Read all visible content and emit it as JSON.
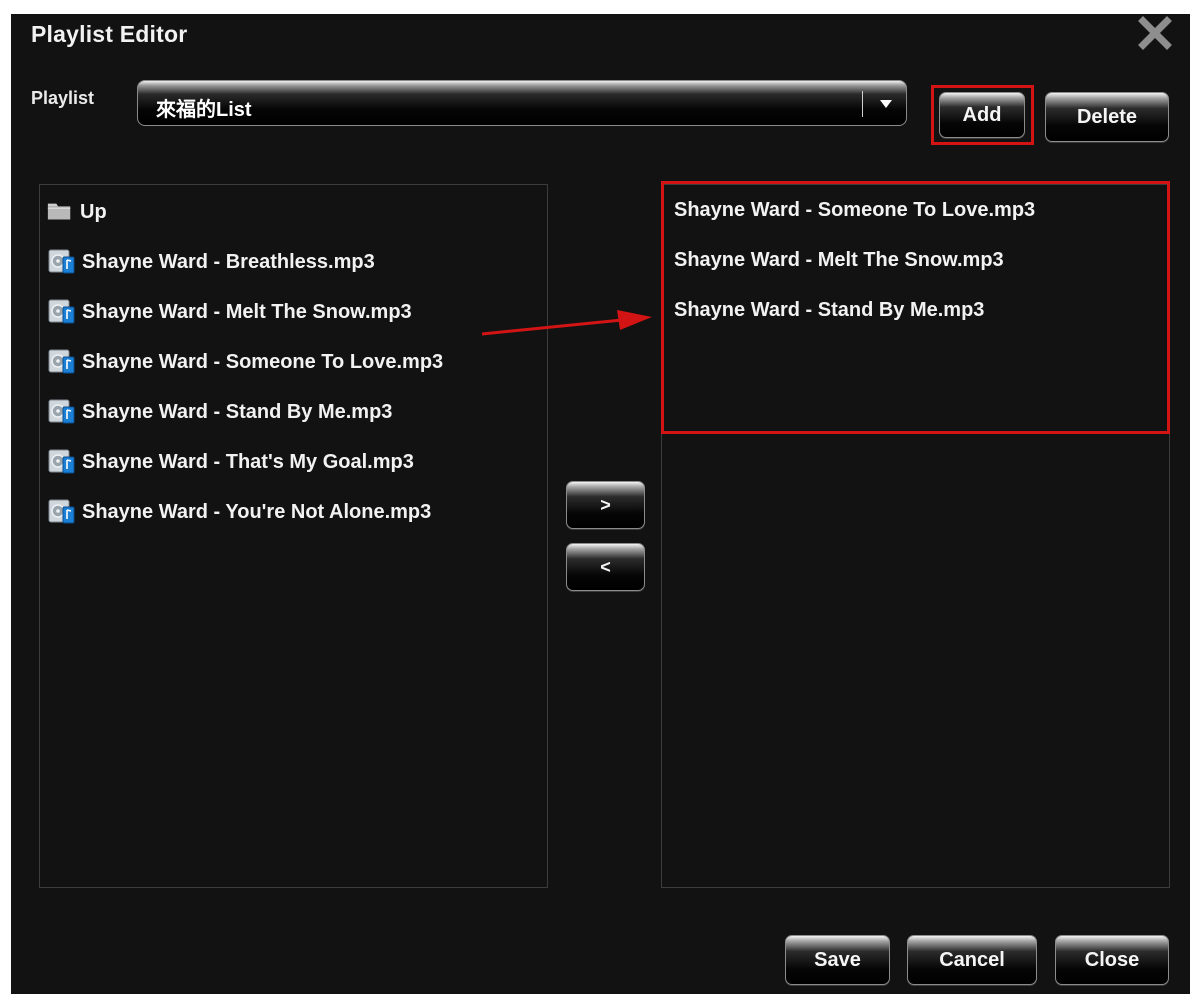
{
  "dialog": {
    "title": "Playlist Editor",
    "close_icon": "close-x-icon"
  },
  "playlist": {
    "label": "Playlist",
    "selected": "來福的List",
    "add_label": "Add",
    "delete_label": "Delete"
  },
  "left_panel": {
    "up_label": "Up",
    "up_icon": "folder-icon",
    "file_icon": "audio-file-icon",
    "files": [
      "Shayne Ward - Breathless.mp3",
      "Shayne Ward - Melt The Snow.mp3",
      "Shayne Ward - Someone To Love.mp3",
      "Shayne Ward - Stand By Me.mp3",
      "Shayne Ward - That's My Goal.mp3",
      "Shayne Ward - You're Not Alone.mp3"
    ]
  },
  "transfer": {
    "add_label": ">",
    "remove_label": "<"
  },
  "right_panel": {
    "items": [
      "Shayne Ward - Someone To Love.mp3",
      "Shayne Ward - Melt The Snow.mp3",
      "Shayne Ward - Stand By Me.mp3"
    ]
  },
  "footer": {
    "save_label": "Save",
    "cancel_label": "Cancel",
    "close_label": "Close"
  },
  "colors": {
    "background": "#121212",
    "highlight": "#d21414"
  }
}
